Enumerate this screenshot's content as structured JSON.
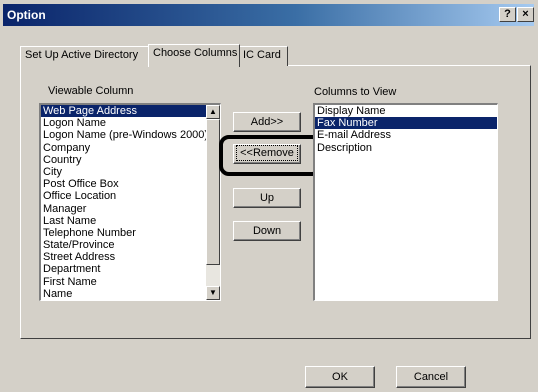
{
  "window": {
    "title": "Option",
    "help_label": "?",
    "close_label": "×"
  },
  "tabs": [
    {
      "label": "Set Up Active Directory",
      "active": false
    },
    {
      "label": "Choose Columns",
      "active": true
    },
    {
      "label": "IC Card",
      "active": false
    }
  ],
  "viewable_column": {
    "label": "Viewable Column",
    "items": [
      "Web Page Address",
      "Logon Name",
      "Logon Name (pre-Windows 2000)",
      "Company",
      "Country",
      "City",
      "Post Office Box",
      "Office Location",
      "Manager",
      "Last Name",
      "Telephone Number",
      "State/Province",
      "Street Address",
      "Department",
      "First Name",
      "Name"
    ],
    "selected_index": 0
  },
  "columns_to_view": {
    "label": "Columns to View",
    "items": [
      "Display Name",
      "Fax Number",
      "E-mail Address",
      "Description"
    ],
    "selected_index": 1
  },
  "buttons": {
    "add": "Add>>",
    "remove": "<<Remove",
    "up": "Up",
    "down": "Down",
    "ok": "OK",
    "cancel": "Cancel"
  },
  "scroll_icons": {
    "up": "▲",
    "down": "▼"
  }
}
